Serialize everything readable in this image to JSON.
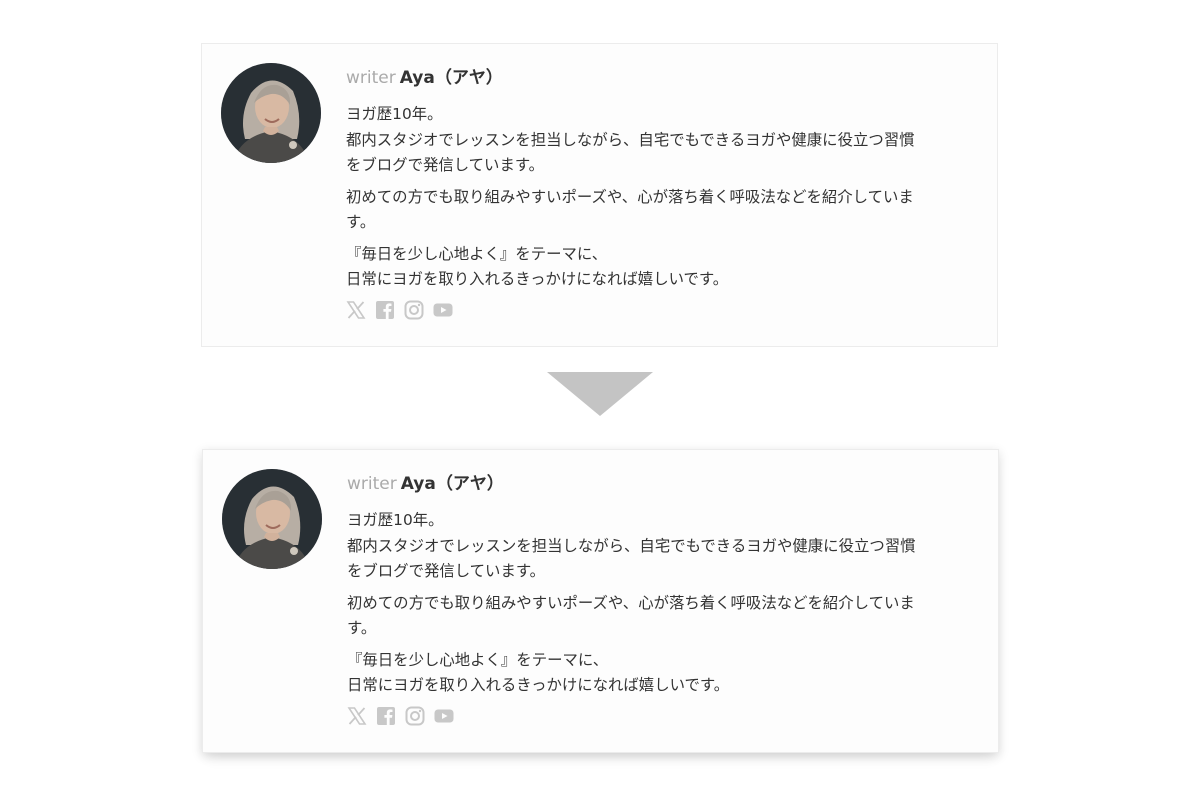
{
  "cards": [
    {
      "writer_label": "writer",
      "writer_name": "Aya（アヤ）",
      "bio": {
        "p1": [
          "ヨガ歴10年。",
          "都内スタジオでレッスンを担当しながら、自宅でもできるヨガや健康に役立つ習慣",
          "をブログで発信しています。"
        ],
        "p2": [
          "初めての方でも取り組みやすいポーズや、心が落ち着く呼吸法などを紹介していま",
          "す。"
        ],
        "p3": [
          "『毎日を少し心地よく』をテーマに、",
          "日常にヨガを取り入れるきっかけになれば嬉しいです。"
        ]
      },
      "social_icons": [
        "x-icon",
        "facebook-icon",
        "instagram-icon",
        "youtube-icon"
      ]
    },
    {
      "writer_label": "writer",
      "writer_name": "Aya（アヤ）",
      "bio": {
        "p1": [
          "ヨガ歴10年。",
          "都内スタジオでレッスンを担当しながら、自宅でもできるヨガや健康に役立つ習慣",
          "をブログで発信しています。"
        ],
        "p2": [
          "初めての方でも取り組みやすいポーズや、心が落ち着く呼吸法などを紹介していま",
          "す。"
        ],
        "p3": [
          "『毎日を少し心地よく』をテーマに、",
          "日常にヨガを取り入れるきっかけになれば嬉しいです。"
        ]
      },
      "social_icons": [
        "x-icon",
        "facebook-icon",
        "instagram-icon",
        "youtube-icon"
      ]
    }
  ],
  "colors": {
    "card_border": "#ececec",
    "writer_label": "#aaaaaa",
    "text": "#333333",
    "icon": "#c8c8c8",
    "arrow": "#c4c4c4"
  }
}
